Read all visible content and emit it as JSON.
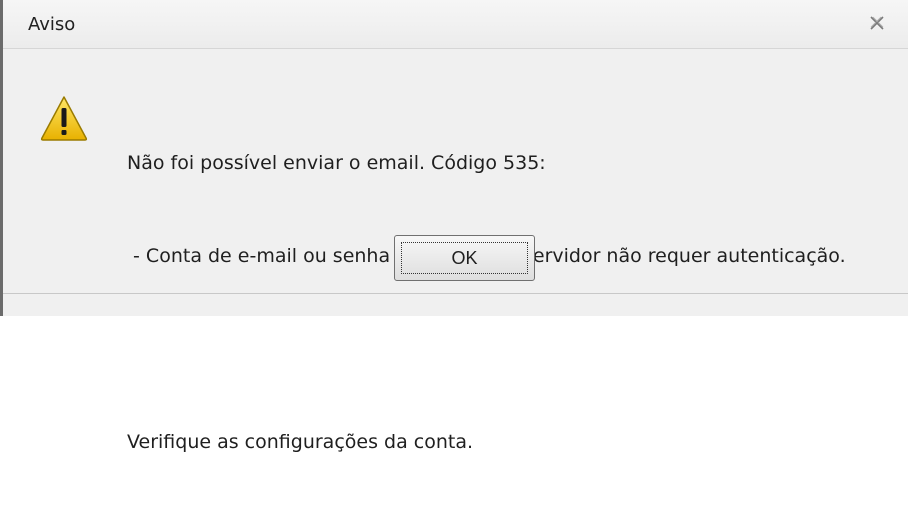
{
  "window": {
    "title": "Aviso",
    "close_icon": "close-icon"
  },
  "message": {
    "icon": "warning-icon",
    "line1": "Não foi possível enviar o email. Código 535:",
    "line2": " - Conta de e-mail ou senha incorreta, ou servidor não requer autenticação.",
    "line3": "",
    "line4": "Verifique as configurações da conta."
  },
  "buttons": {
    "ok_label": "OK"
  },
  "colors": {
    "warning_fill": "#f2c500",
    "dialog_bg": "#f0f0f0"
  }
}
